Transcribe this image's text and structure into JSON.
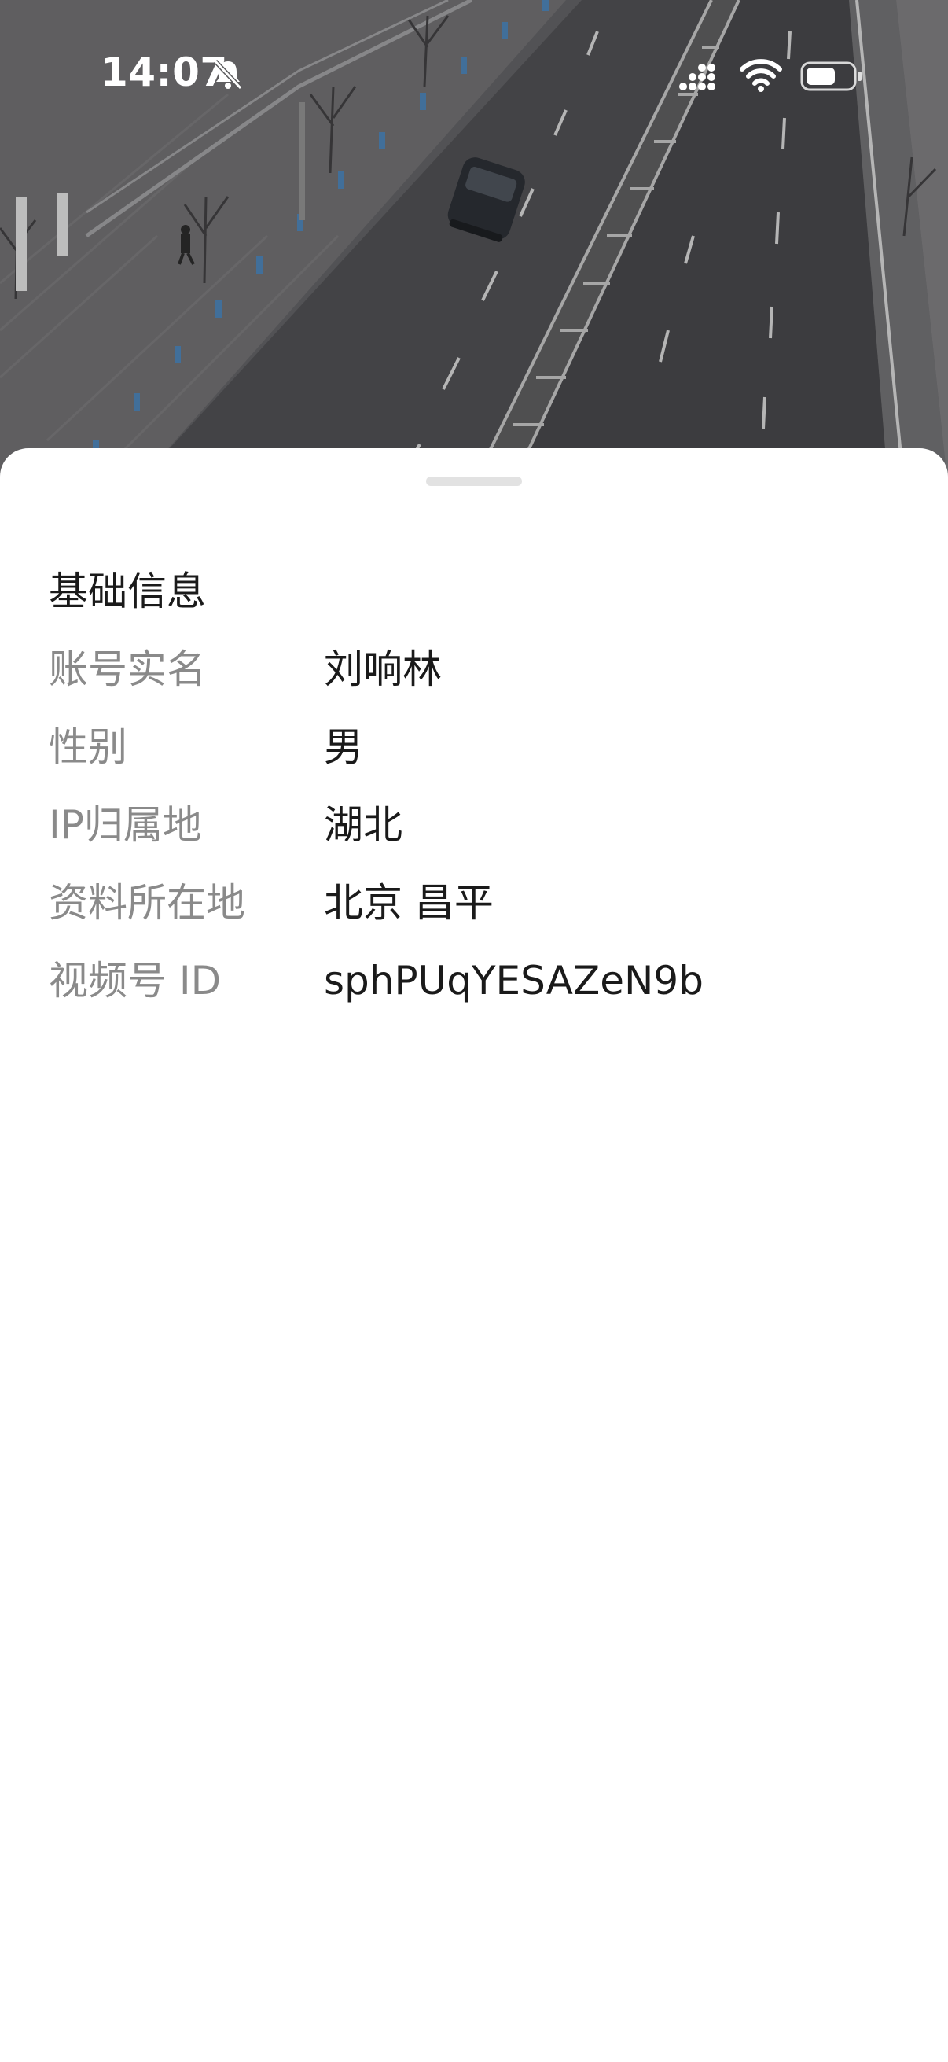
{
  "status_bar": {
    "time": "14:07",
    "icons": [
      "bell-muted-icon",
      "cellular-signal-icon",
      "wifi-icon",
      "battery-icon"
    ]
  },
  "background": {
    "description_icon": "aerial-road-photo"
  },
  "sheet": {
    "section_title": "基础信息",
    "rows": [
      {
        "label": "账号实名",
        "value": "刘响林"
      },
      {
        "label": "性别",
        "value": "男"
      },
      {
        "label": "IP归属地",
        "value": "湖北"
      },
      {
        "label": "资料所在地",
        "value": "北京 昌平"
      },
      {
        "label": "视频号 ID",
        "value": "sphPUqYESAZeN9b"
      }
    ]
  },
  "colors": {
    "label_gray": "#8a8a8a",
    "value_black": "#1a1a1a",
    "handle_gray": "#e2e2e2"
  }
}
